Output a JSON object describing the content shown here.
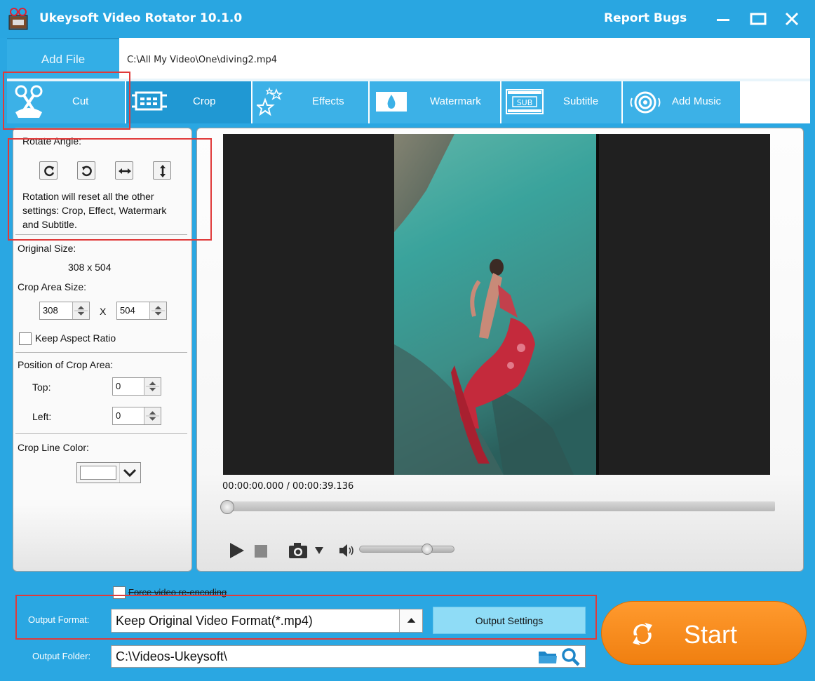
{
  "window": {
    "title": "Ukeysoft Video Rotator 10.1.0",
    "report_bugs": "Report Bugs"
  },
  "file": {
    "add_file_label": "Add File",
    "path": "C:\\All My Video\\One\\diving2.mp4"
  },
  "tabs": [
    {
      "label": "Cut",
      "icon": "scissors-icon"
    },
    {
      "label": "Crop",
      "icon": "crop-icon"
    },
    {
      "label": "Effects",
      "icon": "stars-icon"
    },
    {
      "label": "Watermark",
      "icon": "drop-icon"
    },
    {
      "label": "Subtitle",
      "icon": "subtitle-icon"
    },
    {
      "label": "Add Music",
      "icon": "speaker-icon"
    }
  ],
  "left_panel": {
    "rotate_angle_label": "Rotate Angle:",
    "rotation_note": "Rotation will reset all the other settings: Crop, Effect, Watermark and Subtitle.",
    "original_size_label": "Original Size:",
    "original_size_value": "308 x 504",
    "crop_area_size_label": "Crop Area Size:",
    "crop_width": "308",
    "crop_x_sep": "X",
    "crop_height": "504",
    "keep_aspect_label": "Keep Aspect Ratio",
    "keep_aspect_checked": false,
    "position_label": "Position of Crop Area:",
    "top_label": "Top:",
    "top_value": "0",
    "left_label": "Left:",
    "left_value": "0",
    "crop_line_color_label": "Crop Line Color:",
    "crop_line_color": "#ffffff"
  },
  "player": {
    "timecode": "00:00:00.000 / 00:00:39.136",
    "progress": 0,
    "volume": 0.74
  },
  "bottom": {
    "force_reencode_label": "Force video re-encoding",
    "force_reencode_checked": false,
    "output_format_label": "Output Format:",
    "output_format_value": "Keep Original Video Format(*.mp4)",
    "output_settings_label": "Output Settings",
    "output_folder_label": "Output Folder:",
    "output_folder_value": "C:\\Videos-Ukeysoft\\",
    "start_label": "Start"
  },
  "colors": {
    "brand_blue": "#2aa7e2",
    "tab_blue": "#3cb1e7",
    "start_orange": "#f7891a",
    "highlight_red": "#e03a3a"
  }
}
